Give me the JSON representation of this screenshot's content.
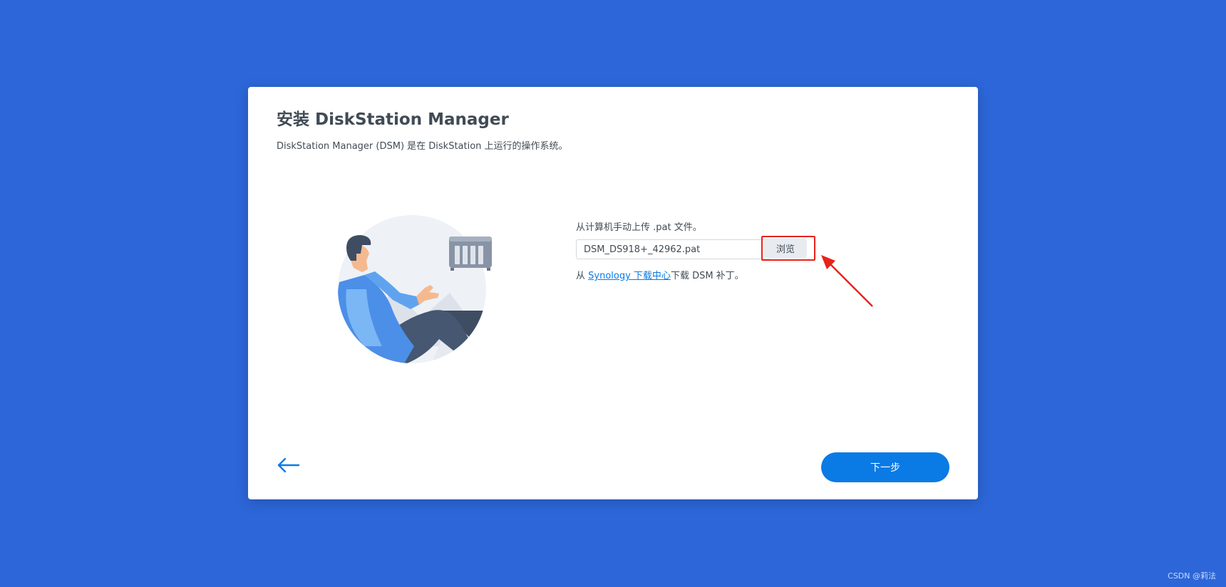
{
  "dialog": {
    "title": "安装 DiskStation Manager",
    "subtitle": "DiskStation Manager (DSM) 是在 DiskStation 上运行的操作系统。"
  },
  "upload": {
    "hint": "从计算机手动上传 .pat 文件。",
    "file_value": "DSM_DS918+_42962.pat",
    "browse_label": "浏览"
  },
  "download": {
    "prefix": "从 ",
    "link_label": "Synology 下载中心",
    "suffix": "下载 DSM 补丁。"
  },
  "footer": {
    "back_icon": "arrow-left-icon",
    "next_label": "下一步"
  },
  "watermark": "CSDN @莉法",
  "colors": {
    "background": "#2c66d8",
    "accent": "#0a7ae5",
    "annotation": "#e8231c"
  }
}
